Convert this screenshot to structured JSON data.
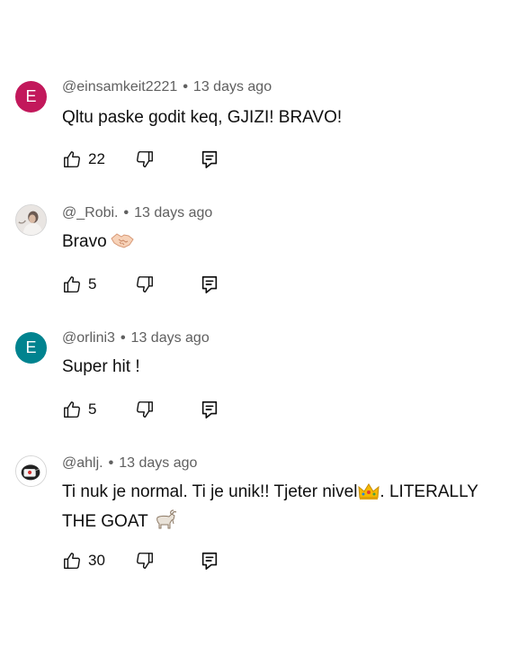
{
  "comments": [
    {
      "author": "@einsamkeit2221",
      "separator": "•",
      "time": "13 days ago",
      "text": "Qltu paske godit keq, GJIZI! BRAVO!",
      "likes": "22",
      "avatar_letter": "E",
      "avatar_color": "#c2185b"
    },
    {
      "author": "@_Robi.",
      "separator": "•",
      "time": "13 days ago",
      "text": "Bravo",
      "emoji": "handshake-emoji",
      "likes": "5",
      "avatar_letter": "",
      "avatar_color": "#e8e4e1"
    },
    {
      "author": "@orlini3",
      "separator": "•",
      "time": "13 days ago",
      "text": "Super hit !",
      "likes": "5",
      "avatar_letter": "E",
      "avatar_color": "#00838f"
    },
    {
      "author": "@ahlj.",
      "separator": "•",
      "time": "13 days ago",
      "text_part1": "Ti nuk je normal. Ti je unik!! Tjeter nivel",
      "text_part2": ". LITERALLY THE GOAT",
      "emojis": [
        "crown-emoji",
        "goat-emoji"
      ],
      "likes": "30",
      "avatar_letter": "",
      "avatar_color": "#ffffff"
    }
  ],
  "icons": {
    "like": "thumbs-up-icon",
    "dislike": "thumbs-down-icon",
    "reply": "reply-comment-icon"
  }
}
